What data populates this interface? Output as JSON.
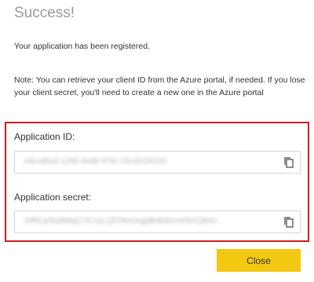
{
  "dialog": {
    "title": "Success!",
    "message": "Your application has been registered.",
    "note": "Note: You can retrieve your client ID from the Azure portal, if needed. If you lose your client secret, you'll need to create a new one in the Azure portal"
  },
  "fields": {
    "app_id": {
      "label": "Application ID:",
      "value": "e9ccd6a3-1396-4ed8-976c-15ceb1f4150"
    },
    "app_secret": {
      "label": "Application secret:",
      "value": "GfRCpStz8fdqQ7A7rpLQ5YAhOsgdB4b50rmPbXQM4="
    }
  },
  "icons": {
    "copy": "copy-icon"
  },
  "buttons": {
    "close": "Close"
  },
  "colors": {
    "highlight_border": "#d01c1c",
    "close_button": "#f2c811",
    "title": "#9a9a9a"
  }
}
